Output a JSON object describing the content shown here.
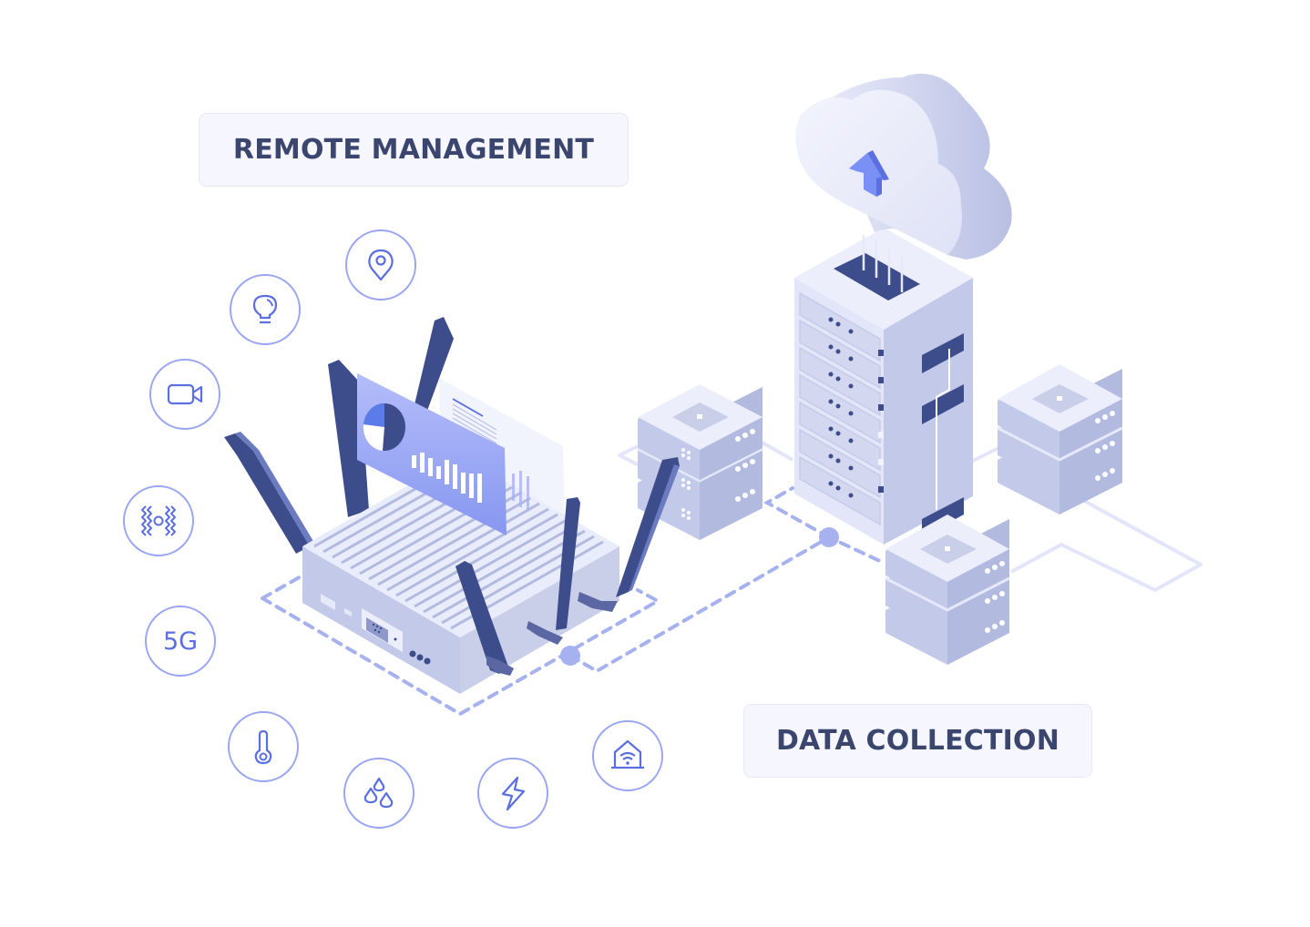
{
  "labels": {
    "remote_management": "REMOTE MANAGEMENT",
    "data_collection": "DATA COLLECTION"
  },
  "sensor_icons": [
    {
      "name": "location-pin",
      "kind": "icon"
    },
    {
      "name": "light-bulb",
      "kind": "icon"
    },
    {
      "name": "video-camera",
      "kind": "icon"
    },
    {
      "name": "vibration",
      "kind": "icon"
    },
    {
      "name": "5g-network",
      "kind": "text",
      "text": "5G"
    },
    {
      "name": "thermometer",
      "kind": "icon"
    },
    {
      "name": "water-drops",
      "kind": "icon"
    },
    {
      "name": "lightning-bolt",
      "kind": "icon"
    },
    {
      "name": "smart-home-wifi",
      "kind": "icon"
    }
  ],
  "illustration": {
    "router": {
      "antennas": 6,
      "ports": [
        "hdmi",
        "usb",
        "serial-db9",
        "status-leds"
      ]
    },
    "dashboard_panel": {
      "chart": "pie-and-bars"
    },
    "cloud": {
      "arrow": "upload"
    },
    "server_rack": {
      "units": 7
    },
    "storage_stacks": 3
  },
  "colors": {
    "text_dark": "#3b466f",
    "accent": "#5b6fe0",
    "circle_stroke": "#9aa6f2",
    "navy": "#3d4d8c",
    "device_light": "#e6e9fa",
    "device_mid": "#c3c9e8",
    "device_shade": "#b2badf",
    "dash": "#a6b2f0",
    "label_bg": "#f5f6fe"
  }
}
